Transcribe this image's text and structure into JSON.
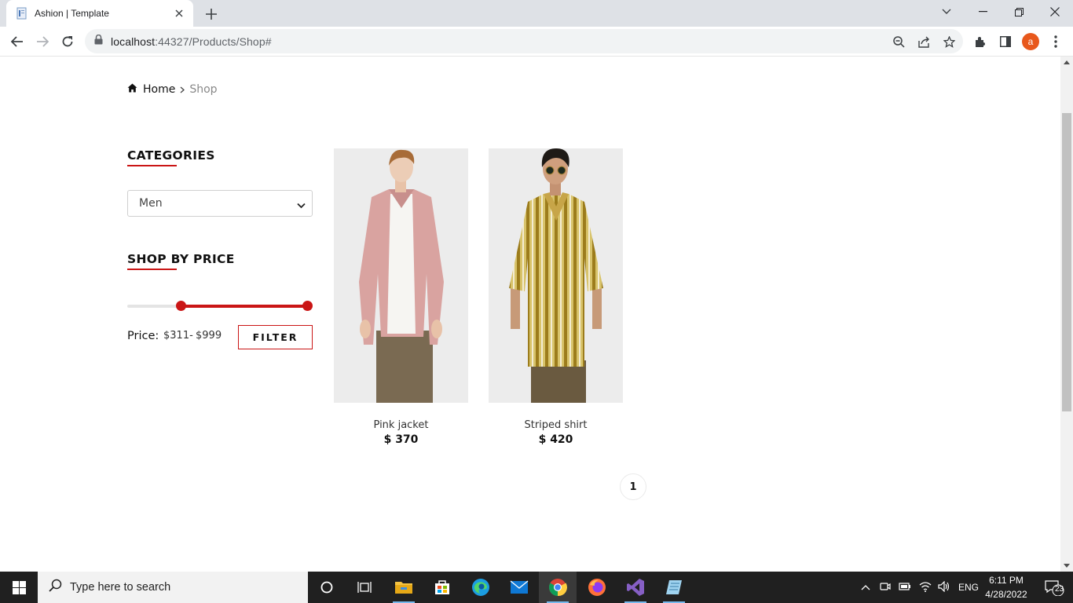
{
  "browser": {
    "tab_title": "Ashion | Template",
    "url_host": "localhost",
    "url_path": ":44327/Products/Shop#",
    "profile_initial": "a"
  },
  "breadcrumb": {
    "home": "Home",
    "current": "Shop"
  },
  "sidebar": {
    "categories_title": "CATEGORIES",
    "category_selected": "Men",
    "price_title": "SHOP BY PRICE",
    "price_label": "Price:",
    "price_min": "$311-",
    "price_max": "$999",
    "filter_button": "FILTER",
    "slider": {
      "min_fraction": 0.28,
      "max_fraction": 1.0
    }
  },
  "products": [
    {
      "name": "Pink jacket",
      "price": "$ 370"
    },
    {
      "name": "Striped shirt",
      "price": "$ 420"
    }
  ],
  "pagination": {
    "current": "1"
  },
  "taskbar": {
    "search_placeholder": "Type here to search",
    "language": "ENG",
    "time": "6:11 PM",
    "date": "4/28/2022",
    "notification_count": "23"
  },
  "colors": {
    "accent": "#ca1515",
    "taskbar": "#202020"
  }
}
